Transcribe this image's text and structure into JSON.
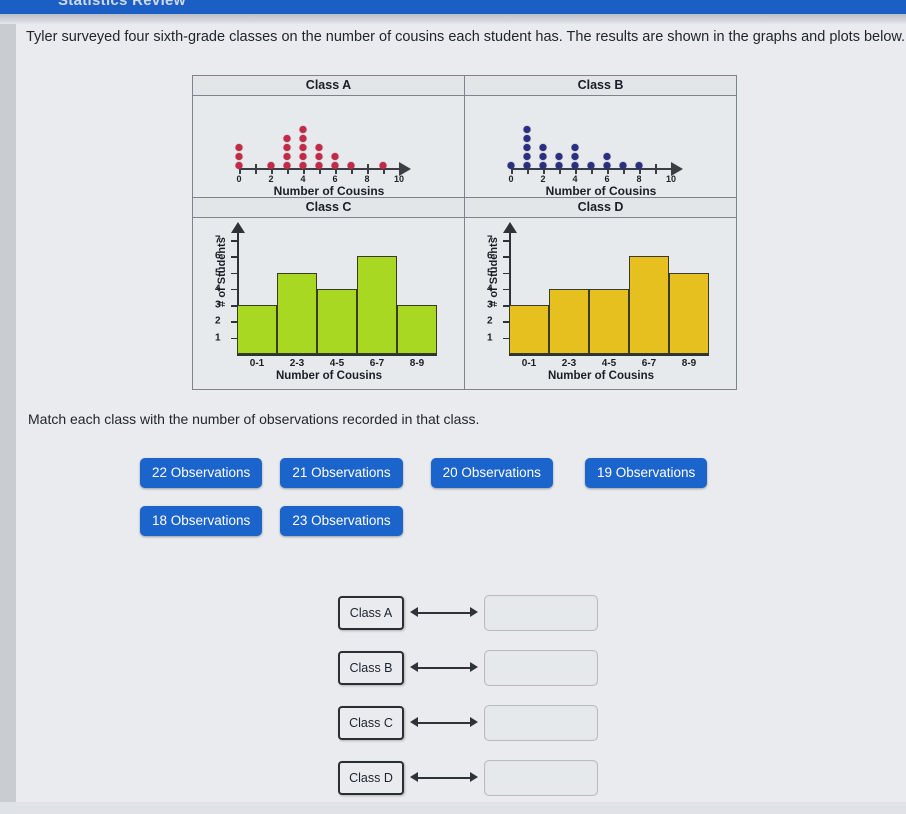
{
  "header": {
    "title": "Statistics Review"
  },
  "prompt": "Tyler surveyed four sixth-grade classes on the number of cousins each student has. The results are shown in the graphs and plots below.",
  "match_instruction": "Match each class with the number of observations recorded in that class.",
  "chart_data": [
    {
      "type": "scatter",
      "title": "Class A",
      "xlabel": "Number of Cousins",
      "ylabel": "",
      "xlim": [
        0,
        11
      ],
      "xticks": [
        0,
        1,
        2,
        3,
        4,
        5,
        6,
        7,
        8,
        9,
        10
      ],
      "xticklabels": [
        "0",
        "",
        "2",
        "",
        "4",
        "",
        "6",
        "",
        "8",
        "",
        "10"
      ],
      "color": "#c22a47",
      "x": [
        0,
        1,
        2,
        3,
        4,
        5,
        6,
        7,
        8,
        9,
        10
      ],
      "values": [
        3,
        0,
        1,
        4,
        5,
        3,
        2,
        1,
        0,
        1,
        0
      ],
      "total_observations": 20
    },
    {
      "type": "scatter",
      "title": "Class B",
      "xlabel": "Number of Cousins",
      "ylabel": "",
      "xlim": [
        0,
        11
      ],
      "xticks": [
        0,
        1,
        2,
        3,
        4,
        5,
        6,
        7,
        8,
        9,
        10
      ],
      "xticklabels": [
        "0",
        "",
        "2",
        "",
        "4",
        "",
        "6",
        "",
        "8",
        "",
        "10"
      ],
      "color": "#2b2f80",
      "x": [
        0,
        1,
        2,
        3,
        4,
        5,
        6,
        7,
        8,
        9,
        10
      ],
      "values": [
        1,
        5,
        3,
        2,
        3,
        1,
        2,
        1,
        1,
        0,
        0
      ],
      "total_observations": 19
    },
    {
      "type": "bar",
      "title": "Class C",
      "xlabel": "Number of Cousins",
      "ylabel": "# of Students",
      "categories": [
        "0-1",
        "2-3",
        "4-5",
        "6-7",
        "8-9"
      ],
      "values": [
        3,
        5,
        4,
        6,
        3
      ],
      "ylim": [
        0,
        7.5
      ],
      "yticks": [
        1,
        2,
        3,
        4,
        5,
        6,
        7
      ],
      "color": "#a9d823",
      "total_observations": 21
    },
    {
      "type": "bar",
      "title": "Class D",
      "xlabel": "Number of Cousins",
      "ylabel": "# of Students",
      "categories": [
        "0-1",
        "2-3",
        "4-5",
        "6-7",
        "8-9"
      ],
      "values": [
        3,
        4,
        4,
        6,
        5
      ],
      "ylim": [
        0,
        7.5
      ],
      "yticks": [
        1,
        2,
        3,
        4,
        5,
        6,
        7
      ],
      "color": "#e5c01e",
      "total_observations": 22
    }
  ],
  "options": {
    "row1": [
      "22 Observations",
      "21 Observations",
      "20 Observations",
      "19 Observations"
    ],
    "row2": [
      "18 Observations",
      "23 Observations"
    ]
  },
  "match_rows": [
    {
      "label": "Class A",
      "answer": ""
    },
    {
      "label": "Class B",
      "answer": ""
    },
    {
      "label": "Class C",
      "answer": ""
    },
    {
      "label": "Class D",
      "answer": ""
    }
  ],
  "colors": {
    "accent_blue": "#1b64cc",
    "header_blue": "#1c5fc4",
    "classA_dot": "#c22a47",
    "classB_dot": "#2b2f80",
    "classC_bar": "#a9d823",
    "classD_bar": "#e5c01e"
  }
}
